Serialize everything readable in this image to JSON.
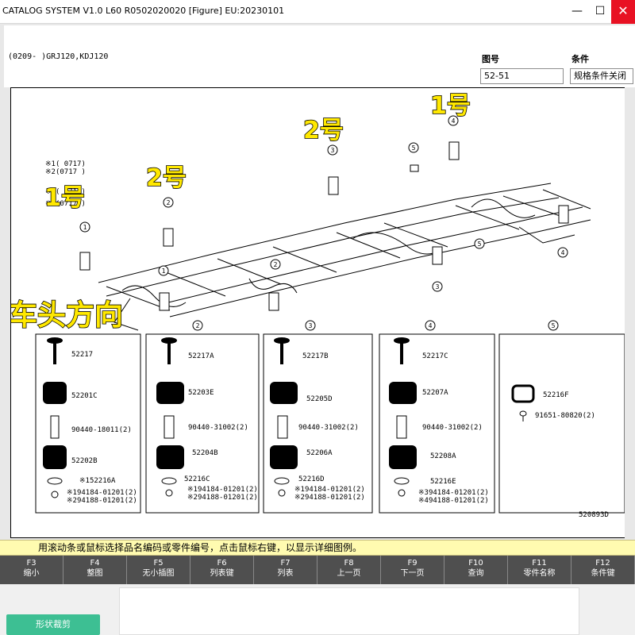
{
  "window": {
    "title": "CATALOG SYSTEM V1.0 L60 R0502020020 [Figure] EU:20230101",
    "minimize_glyph": "—",
    "maximize_glyph": "☐",
    "close_glyph": "✕"
  },
  "header": {
    "model_code": "(0209-      )GRJ120,KDJ120",
    "figure_no_label": "图号",
    "figure_no_value": "52-51",
    "condition_label": "条件",
    "condition_value": "规格条件关闭"
  },
  "figure": {
    "overlay_labels": {
      "no1_left": "1号",
      "no2_left": "2号",
      "no2_top": "2号",
      "no1_top": "1号",
      "front_direction": "车头方向"
    },
    "notes": [
      "※1(     0717)",
      "※2(0717     )",
      "※3(     0717)",
      "※4(0717     )"
    ],
    "callouts": [
      "1",
      "2",
      "3",
      "4",
      "5"
    ],
    "groups": [
      {
        "circle": "1",
        "parts": [
          {
            "code": "52217"
          },
          {
            "code": "52201C"
          },
          {
            "code": "90440-18011(2)"
          },
          {
            "code": "52202B"
          },
          {
            "code": "※152216A"
          },
          {
            "code": "※194184-01201(2)"
          },
          {
            "code": "※294188-01201(2)"
          }
        ]
      },
      {
        "circle": "2",
        "parts": [
          {
            "code": "52217A"
          },
          {
            "code": "52203E"
          },
          {
            "code": "90440-31002(2)"
          },
          {
            "code": "52204B"
          },
          {
            "code": "52216C"
          },
          {
            "code": "※194184-01201(2)"
          },
          {
            "code": "※294188-01201(2)"
          }
        ]
      },
      {
        "circle": "3",
        "parts": [
          {
            "code": "52217B"
          },
          {
            "code": "52205D"
          },
          {
            "code": "90440-31002(2)"
          },
          {
            "code": "52206A"
          },
          {
            "code": "52216D"
          },
          {
            "code": "※194184-01201(2)"
          },
          {
            "code": "※294188-01201(2)"
          }
        ]
      },
      {
        "circle": "4",
        "parts": [
          {
            "code": "52217C"
          },
          {
            "code": "52207A"
          },
          {
            "code": "90440-31002(2)"
          },
          {
            "code": "52208A"
          },
          {
            "code": "52216E"
          },
          {
            "code": "※394184-01201(2)"
          },
          {
            "code": "※494188-01201(2)"
          }
        ]
      },
      {
        "circle": "5",
        "parts": [
          {
            "code": "52216F"
          },
          {
            "code": "91651-80820(2)"
          }
        ]
      }
    ],
    "figure_id": "520893D"
  },
  "hint": "用滚动条或鼠标选择品名编码或零件编号，点击鼠标右键，以显示详细图例。",
  "fkeys": [
    {
      "key": "F3",
      "label": "缩小"
    },
    {
      "key": "F4",
      "label": "整图"
    },
    {
      "key": "F5",
      "label": "无小插图"
    },
    {
      "key": "F6",
      "label": "列表键"
    },
    {
      "key": "F7",
      "label": "列表"
    },
    {
      "key": "F8",
      "label": "上一页"
    },
    {
      "key": "F9",
      "label": "下一页"
    },
    {
      "key": "F10",
      "label": "查询"
    },
    {
      "key": "F11",
      "label": "零件名称"
    },
    {
      "key": "F12",
      "label": "条件键"
    }
  ],
  "shape_crop_button": "形状裁剪",
  "colors": {
    "overlay_yellow": "#ffe800",
    "hint_bg": "#fffbb0",
    "fkey_bg": "#4f4f4f",
    "shape_btn": "#3dbf93",
    "close_red": "#e81123"
  }
}
